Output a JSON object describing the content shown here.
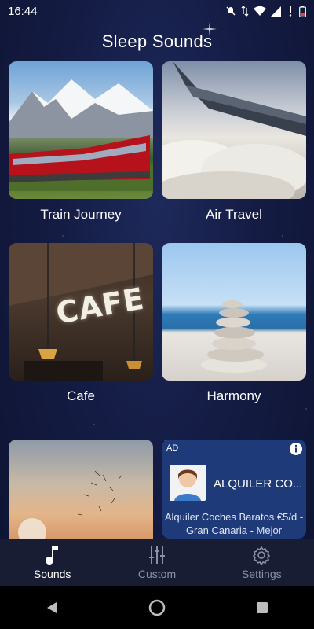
{
  "status_bar": {
    "time": "16:44"
  },
  "header": {
    "title": "Sleep Sounds"
  },
  "sounds": [
    {
      "label": "Train Journey"
    },
    {
      "label": "Air Travel"
    },
    {
      "label": "Cafe",
      "sign_text": "CAFE"
    },
    {
      "label": "Harmony"
    },
    {
      "label": ""
    }
  ],
  "ad": {
    "badge": "AD",
    "title": "ALQUILER CO...",
    "description": "Alquiler Coches Baratos €5/d - Gran Canaria - Mejor"
  },
  "bottom_nav": [
    {
      "label": "Sounds",
      "icon": "music-note-icon",
      "active": true
    },
    {
      "label": "Custom",
      "icon": "sliders-icon",
      "active": false
    },
    {
      "label": "Settings",
      "icon": "gear-icon",
      "active": false
    }
  ],
  "colors": {
    "background": "#141c44",
    "ad_background": "#1f3a78",
    "nav_background": "#181d33",
    "nav_inactive": "#8a90a6"
  }
}
